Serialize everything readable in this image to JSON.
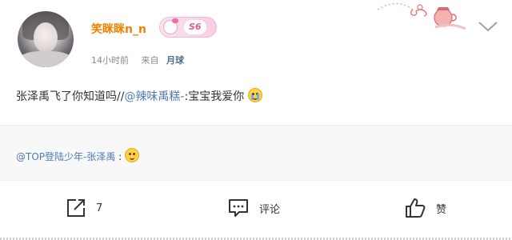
{
  "post": {
    "user": {
      "name": "笑眯眯n_n",
      "level_badge": "S6",
      "avatar_icon": "avatar-photo"
    },
    "meta": {
      "time": "14小时前",
      "from_label": "来自",
      "source": "月球"
    },
    "content": {
      "text_before": "张泽禹飞了你知道吗//",
      "mention": "@辣味禹糕-",
      "text_after": ":宝宝我爱你",
      "emoji": "crying-emoji"
    },
    "retweet": {
      "mention": "@TOP登陆少年-张泽禹",
      "separator": " :",
      "emoji": "smile-emoji"
    },
    "actions": {
      "share_count": "7",
      "comment_label": "评论",
      "like_label": "赞"
    }
  },
  "colors": {
    "username": "#f08200",
    "link": "#4d7cb5",
    "retweet_bg": "#f8f8f8",
    "text": "#333333",
    "meta": "#888888"
  }
}
